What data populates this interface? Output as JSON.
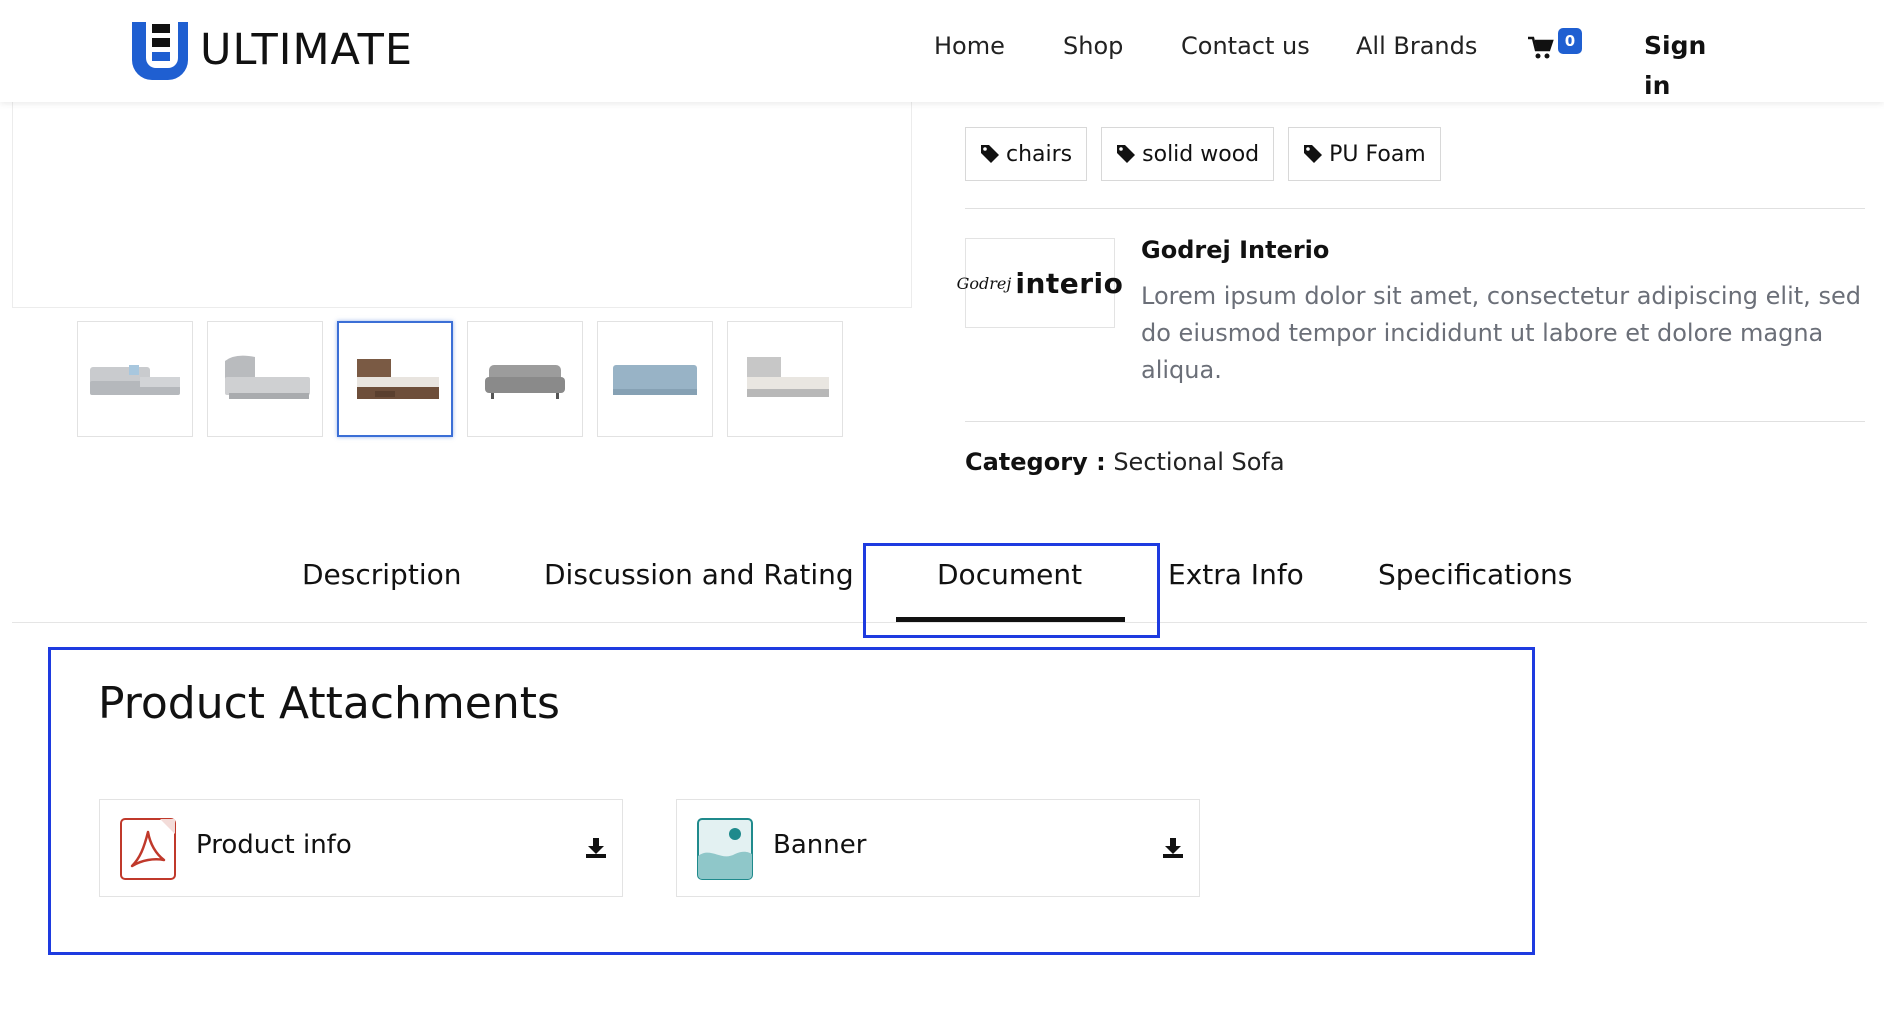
{
  "header": {
    "logo_text": "ULTIMATE",
    "nav": [
      "Home",
      "Shop",
      "Contact us",
      "All Brands"
    ],
    "cart_count": "0",
    "signin_label": "Sign in"
  },
  "product": {
    "tags": [
      "chairs",
      "solid wood",
      "PU Foam"
    ],
    "brand": {
      "logo_script": "Godrej",
      "logo_word": "interio",
      "name": "Godrej Interio",
      "description": "Lorem ipsum dolor sit amet, consectetur adipiscing elit, sed do eiusmod tempor incididunt ut labore et dolore magna aliqua."
    },
    "category_label": "Category :",
    "category_value": "Sectional Sofa"
  },
  "tabs": [
    "Description",
    "Discussion and Rating",
    "Document",
    "Extra Info",
    "Specifications"
  ],
  "active_tab": "Document",
  "attachments": {
    "title": "Product Attachments",
    "files": [
      {
        "name": "Product info",
        "icon": "pdf-icon"
      },
      {
        "name": "Banner",
        "icon": "image-file-icon"
      }
    ]
  },
  "colors": {
    "accent": "#1f5fd1",
    "highlight": "#1e3be0",
    "muted_text": "#6b6f78"
  }
}
